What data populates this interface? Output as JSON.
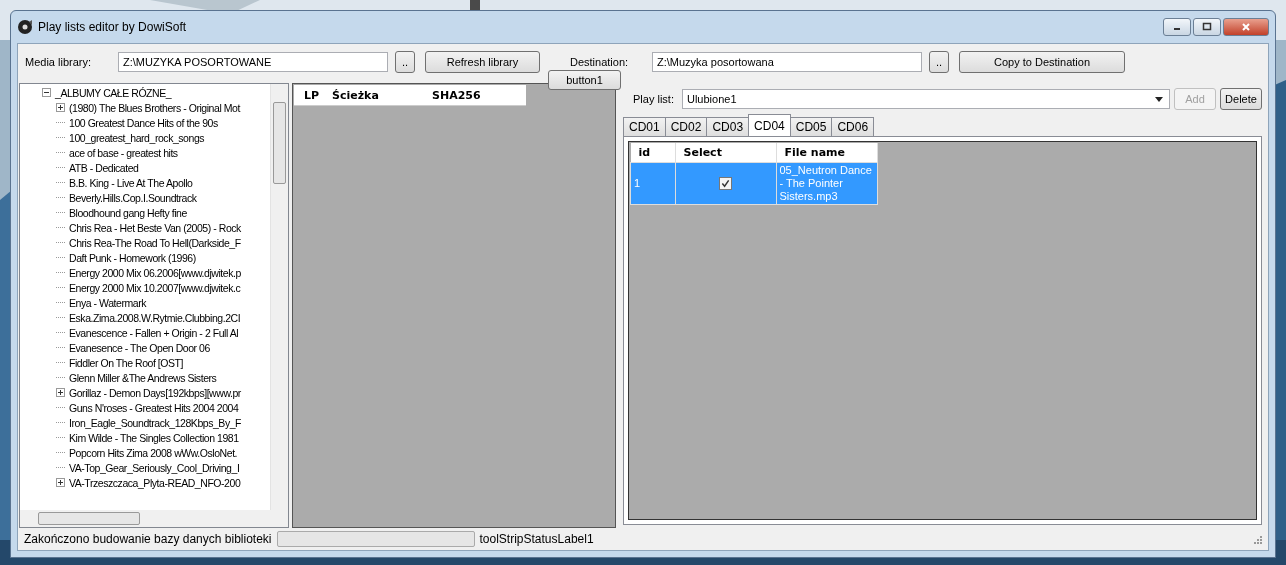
{
  "window": {
    "title": "Play lists editor by DowiSoft"
  },
  "toolbar": {
    "media_label": "Media library:",
    "media_path": "Z:\\MUZYKA POSORTOWANE",
    "browse_media": "..",
    "refresh": "Refresh library",
    "button1": "button1",
    "destination_label": "Destination:",
    "destination_path": "Z:\\Muzyka posortowana",
    "browse_destination": "..",
    "copy": "Copy to Destination"
  },
  "tree": {
    "root": {
      "label": "_ALBUMY CAŁE RÓZNE_",
      "expanded": true,
      "children": [
        {
          "label": "(1980) The Blues Brothers - Original Mot",
          "kind": "collapsed"
        },
        {
          "label": "100 Greatest Dance Hits of the 90s",
          "kind": "leaf"
        },
        {
          "label": "100_greatest_hard_rock_songs",
          "kind": "leaf"
        },
        {
          "label": "ace of base - greatest hits",
          "kind": "leaf"
        },
        {
          "label": "ATB - Dedicated",
          "kind": "leaf"
        },
        {
          "label": "B.B. King - Live At The Apollo",
          "kind": "leaf"
        },
        {
          "label": "Beverly.Hills.Cop.I.Soundtrack",
          "kind": "leaf"
        },
        {
          "label": "Bloodhound gang Hefty fine",
          "kind": "leaf"
        },
        {
          "label": "Chris Rea - Het Beste Van (2005) - Rock",
          "kind": "leaf"
        },
        {
          "label": "Chris Rea-The Road To Hell(Darkside_F",
          "kind": "leaf"
        },
        {
          "label": "Daft Punk - Homework (1996)",
          "kind": "leaf"
        },
        {
          "label": "Energy 2000 Mix 06.2006[www.djwitek.p",
          "kind": "leaf"
        },
        {
          "label": "Energy 2000 Mix 10.2007[www.djwitek.c",
          "kind": "leaf"
        },
        {
          "label": "Enya - Watermark",
          "kind": "leaf"
        },
        {
          "label": "Eska.Zima.2008.W.Rytmie.Clubbing.2CI",
          "kind": "leaf"
        },
        {
          "label": "Evanescence - Fallen + Origin - 2 Full Al",
          "kind": "leaf"
        },
        {
          "label": "Evanesence - The Open Door 06",
          "kind": "leaf"
        },
        {
          "label": "Fiddler On The Roof [OST]",
          "kind": "leaf"
        },
        {
          "label": "Glenn Miller &The Andrews Sisters",
          "kind": "leaf"
        },
        {
          "label": "Gorillaz - Demon Days[192kbps][www.pr",
          "kind": "collapsed"
        },
        {
          "label": "Guns N'roses - Greatest Hits 2004 2004",
          "kind": "leaf"
        },
        {
          "label": "Iron_Eagle_Soundtrack_128Kbps_By_F",
          "kind": "leaf"
        },
        {
          "label": "Kim Wilde - The Singles Collection 1981",
          "kind": "leaf"
        },
        {
          "label": "Popcorn Hits Zima 2008 wWw.OsloNet.",
          "kind": "leaf"
        },
        {
          "label": "VA-Top_Gear_Seriously_Cool_Driving_I",
          "kind": "leaf"
        },
        {
          "label": "VA-Trzeszczaca_Plyta-READ_NFO-200",
          "kind": "collapsed"
        }
      ]
    }
  },
  "tracks_table": {
    "columns": [
      "LP",
      "Ścieżka",
      "SHA256"
    ]
  },
  "playlist": {
    "label": "Play list:",
    "value": "Ulubione1",
    "add": "Add",
    "add_disabled": true,
    "delete": "Delete"
  },
  "tabs": [
    {
      "label": "CD01",
      "selected": false
    },
    {
      "label": "CD02",
      "selected": false
    },
    {
      "label": "CD03",
      "selected": false
    },
    {
      "label": "CD04",
      "selected": true
    },
    {
      "label": "CD05",
      "selected": false
    },
    {
      "label": "CD06",
      "selected": false
    }
  ],
  "files_table": {
    "columns": [
      "id",
      "Select",
      "File name"
    ],
    "rows": [
      {
        "id": "1",
        "checked": true,
        "file_name": "05_Neutron Dance - The Pointer Sisters.mp3",
        "selected": true
      }
    ]
  },
  "status_bar": {
    "message": "Zakończono budowanie bazy danych biblioteki",
    "progress": {
      "level": 0
    },
    "label": "toolStripStatusLabel1"
  }
}
